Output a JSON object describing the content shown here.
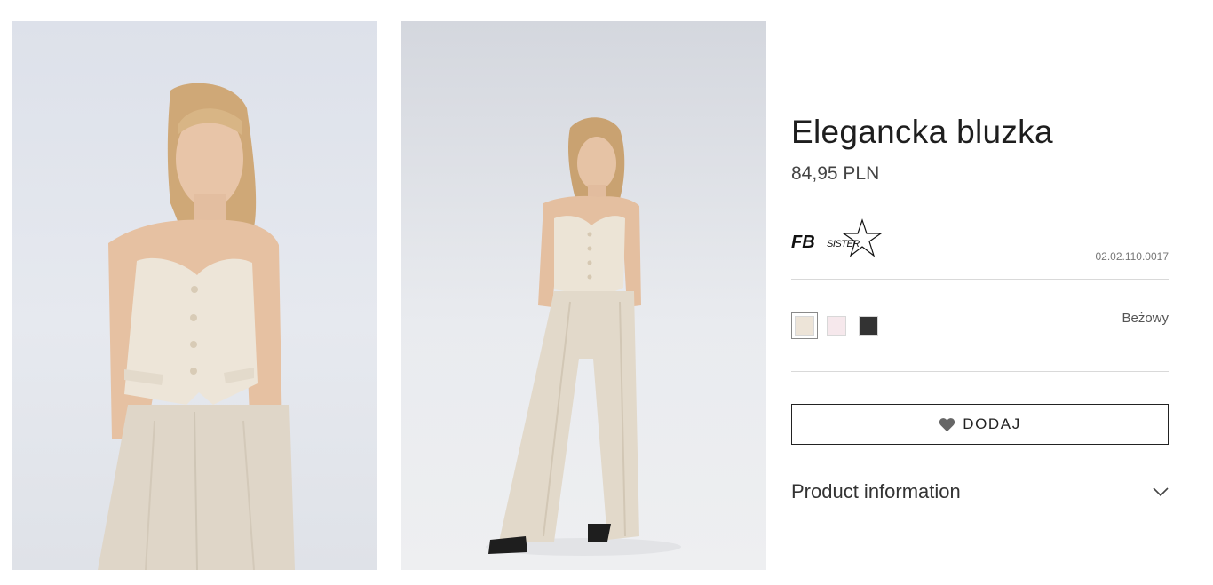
{
  "product": {
    "title": "Elegancka bluzka",
    "price": "84,95 PLN",
    "brand": "FB SISTER",
    "sku": "02.02.110.0017"
  },
  "images": [
    {
      "icon": "product-photo-front",
      "alt": "Model in beige strapless vest and wide trousers, front close-up"
    },
    {
      "icon": "product-photo-full",
      "alt": "Model in beige strapless vest and wide trousers, full length"
    }
  ],
  "colors": {
    "selected_label": "Beżowy",
    "swatches": [
      {
        "name": "beige",
        "hex": "#ede4d8",
        "selected": true
      },
      {
        "name": "light-pink",
        "hex": "#f6e8ec",
        "selected": false
      },
      {
        "name": "black",
        "hex": "#333333",
        "selected": false
      }
    ]
  },
  "actions": {
    "add_label": "DODAJ",
    "add_icon": "heart-icon"
  },
  "accordion": {
    "product_info_label": "Product information",
    "icon": "chevron-down-icon"
  }
}
